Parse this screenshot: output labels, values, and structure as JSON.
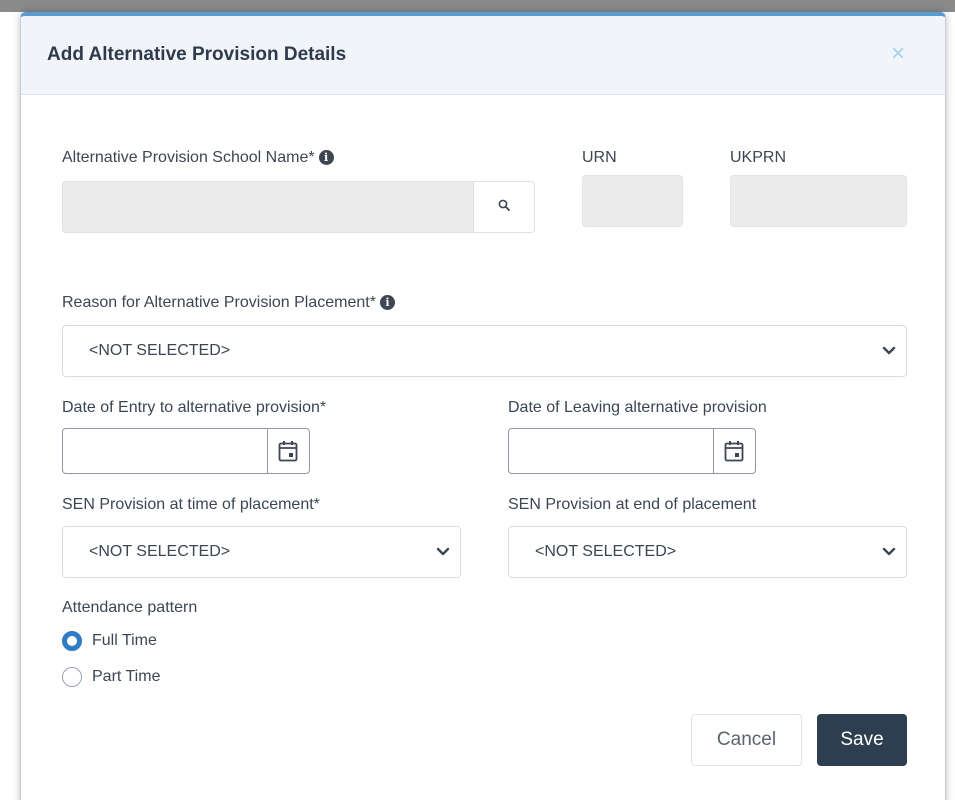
{
  "dialog": {
    "title": "Add Alternative Provision Details",
    "close_symbol": "×"
  },
  "school": {
    "label": "Alternative Provision School Name*",
    "value": "",
    "search_icon": "search-icon",
    "info_icon": "info-icon"
  },
  "urn": {
    "label": "URN",
    "value": ""
  },
  "ukprn": {
    "label": "UKPRN",
    "value": ""
  },
  "reason": {
    "label": "Reason for Alternative Provision Placement*",
    "selected": "<NOT SELECTED>"
  },
  "entry_date": {
    "label": "Date of Entry to alternative provision*",
    "value": ""
  },
  "leaving_date": {
    "label": "Date of Leaving alternative provision",
    "value": ""
  },
  "sen_start": {
    "label": "SEN Provision at time of placement*",
    "selected": "<NOT SELECTED>"
  },
  "sen_end": {
    "label": "SEN Provision at end of placement",
    "selected": "<NOT SELECTED>"
  },
  "attendance": {
    "label": "Attendance pattern",
    "options": [
      {
        "label": "Full Time",
        "checked": true
      },
      {
        "label": "Part Time",
        "checked": false
      }
    ]
  },
  "actions": {
    "cancel": "Cancel",
    "save": "Save"
  },
  "colors": {
    "accent": "#2f7cc4",
    "header_bg": "#f1f5fa",
    "save_bg": "#2d3e50",
    "top_border": "#5b9bd5"
  }
}
